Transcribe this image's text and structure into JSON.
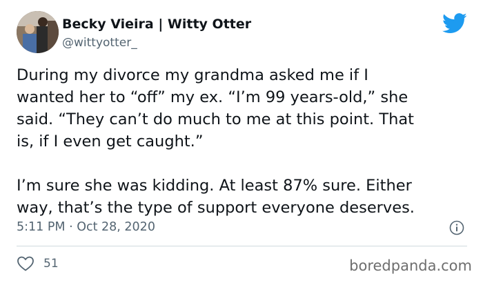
{
  "author": {
    "name": "Becky Vieira | Witty Otter",
    "handle": "@wittyotter_",
    "avatar_icon": "family-photo-avatar"
  },
  "brand": {
    "icon": "twitter-bird-icon",
    "color": "#1d9bf0"
  },
  "tweet": {
    "lines": [
      "During my divorce my grandma asked me if I",
      "wanted her to “off” my ex. “I’m 99 years-old,” she",
      "said. “They can’t do much to me at this point. That",
      "is, if I even get caught.”",
      "I’m sure she was kidding. At least 87% sure. Either",
      "way, that’s the type of support everyone deserves."
    ],
    "timestamp": "5:11 PM · Oct 28, 2020"
  },
  "actions": {
    "like_icon": "heart-icon",
    "like_count": "51",
    "info_icon": "info-icon"
  },
  "watermark": "boredpanda.com"
}
